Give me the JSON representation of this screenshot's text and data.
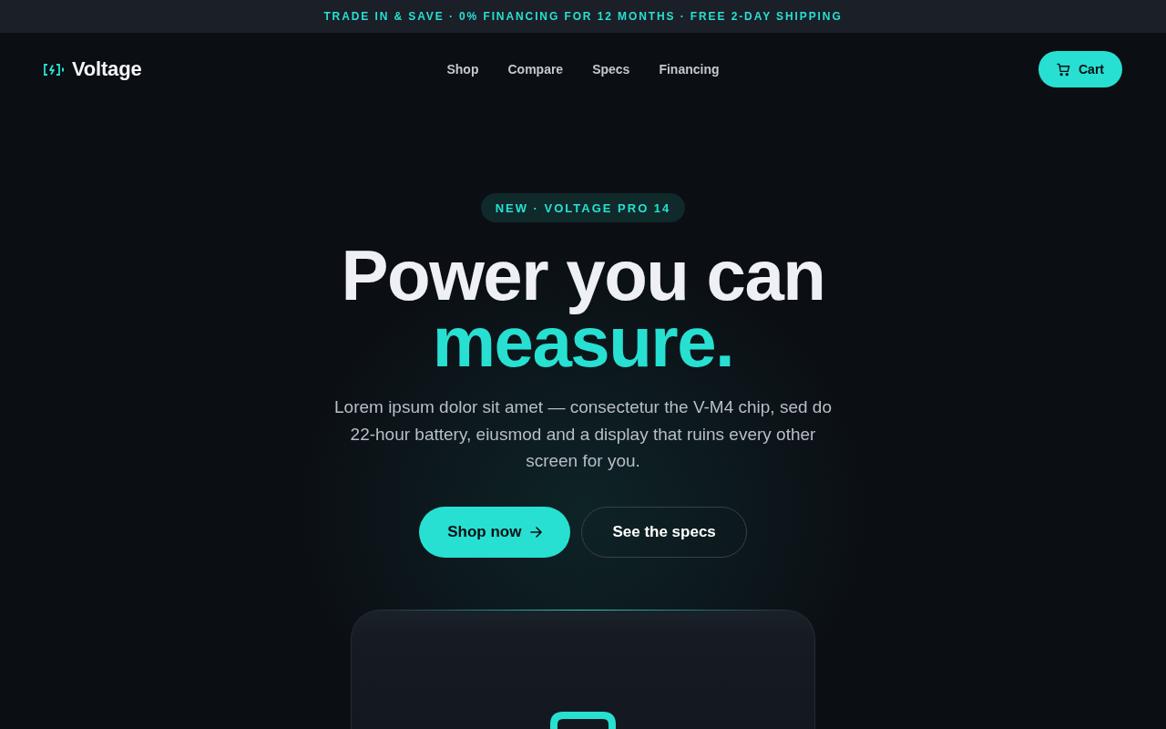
{
  "announcement": "TRADE IN & SAVE · 0% FINANCING FOR 12 MONTHS · FREE 2-DAY SHIPPING",
  "header": {
    "logo": "Voltage",
    "nav": [
      "Shop",
      "Compare",
      "Specs",
      "Financing"
    ],
    "cart_button": "Cart"
  },
  "hero": {
    "badge": "NEW · VOLTAGE PRO 14",
    "headline": "Power you can",
    "headline_accent": "measure.",
    "description": "Lorem ipsum dolor sit amet — consectetur the V-M4 chip, sed do 22-hour battery, eiusmod and a display that ruins every other screen for you.",
    "buttons": [
      {
        "label": "Shop now",
        "kind": "primary"
      },
      {
        "label": "See the specs",
        "kind": "secondary"
      }
    ]
  }
}
